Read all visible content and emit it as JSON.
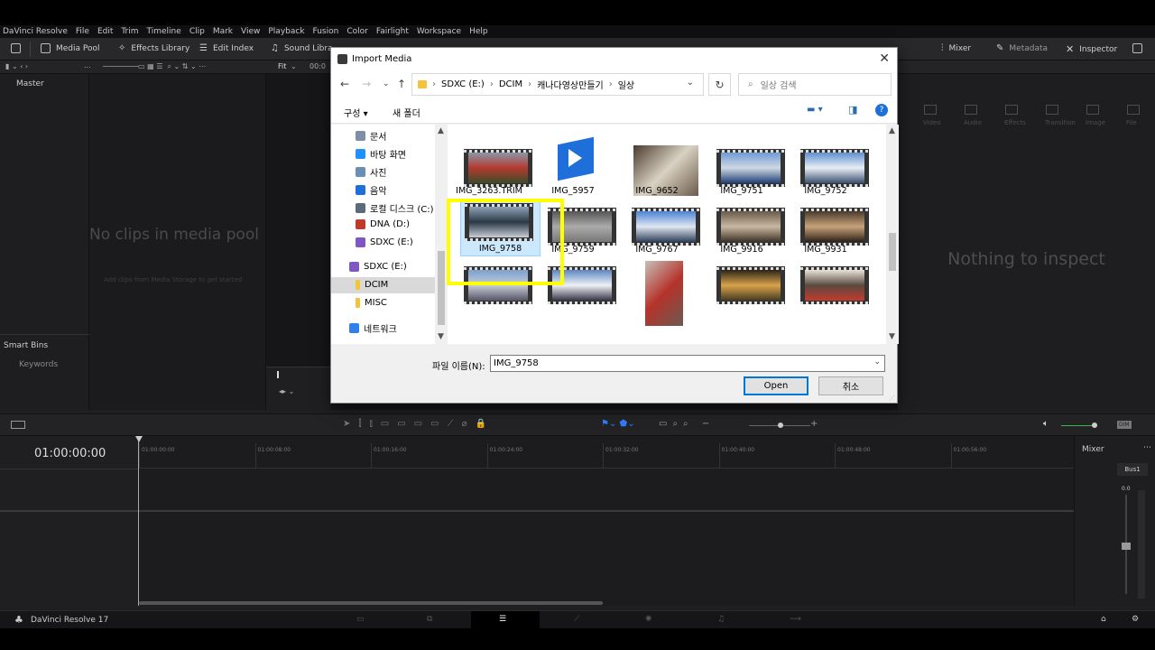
{
  "menubar": [
    "DaVinci Resolve",
    "File",
    "Edit",
    "Trim",
    "Timeline",
    "Clip",
    "Mark",
    "View",
    "Playback",
    "Fusion",
    "Color",
    "Fairlight",
    "Workspace",
    "Help"
  ],
  "toolbar": {
    "media_pool": "Media Pool",
    "effects_library": "Effects Library",
    "edit_index": "Edit Index",
    "sound_library": "Sound Libra",
    "mixer": "Mixer",
    "metadata": "Metadata",
    "inspector": "Inspector"
  },
  "subbar": {
    "fit": "Fit",
    "timecode": "00:0",
    "ellipsis": "..."
  },
  "media_pool": {
    "master": "Master",
    "empty_title": "No clips in media pool",
    "empty_hint": "Add clips from Media Storage to get started",
    "smart_bins": "Smart Bins",
    "keywords": "Keywords"
  },
  "inspector": {
    "empty": "Nothing to inspect",
    "tabs": [
      "Video",
      "Audio",
      "Effects",
      "Transition",
      "Image",
      "File"
    ]
  },
  "timeline": {
    "timecode": "01:00:00:00",
    "ruler": [
      "01:00:00:00",
      "01:00:08:00",
      "01:00:16:00",
      "01:00:24:00",
      "01:00:32:00",
      "01:00:40:00",
      "01:00:48:00",
      "01:00:56:00"
    ]
  },
  "mixer": {
    "title": "Mixer",
    "bus": "Bus1",
    "level": "0.0",
    "dim": "DIM"
  },
  "footer": {
    "app_name": "DaVinci Resolve 17"
  },
  "dialog": {
    "title": "Import Media",
    "breadcrumb": [
      "SDXC (E:)",
      "DCIM",
      "캐나다영상만들기",
      "일상"
    ],
    "search_placeholder": "일상 검색",
    "organize": "구성 ▾",
    "new_folder": "새 폴더",
    "nav": [
      {
        "label": "문서",
        "icon": "document-icon",
        "color": "#7b8fa6"
      },
      {
        "label": "바탕 화면",
        "icon": "desktop-icon",
        "color": "#1e90ff"
      },
      {
        "label": "사진",
        "icon": "pictures-icon",
        "color": "#6a8fb5"
      },
      {
        "label": "음악",
        "icon": "music-icon",
        "color": "#1e6fd9"
      },
      {
        "label": "로컬 디스크 (C:)",
        "icon": "disk-icon",
        "color": "#5a6b7c"
      },
      {
        "label": "DNA (D:)",
        "icon": "drive-icon",
        "color": "#c0392b"
      },
      {
        "label": "SDXC (E:)",
        "icon": "sdcard-icon",
        "color": "#7e57c2"
      },
      {
        "label": "SDXC (E:)",
        "icon": "sdcard-icon",
        "color": "#7e57c2"
      },
      {
        "label": "DCIM",
        "icon": "folder-icon",
        "color": "#f3c43b"
      },
      {
        "label": "MISC",
        "icon": "folder-icon",
        "color": "#f3c43b"
      },
      {
        "label": "네트워크",
        "icon": "network-icon",
        "color": "#2f80ed"
      }
    ],
    "files": [
      {
        "name": "IMG_3263.TRIM",
        "kind": "video",
        "colors": [
          "#8a97a8",
          "#b53a2e",
          "#3b4c2a"
        ]
      },
      {
        "name": "IMG_5957",
        "kind": "app"
      },
      {
        "name": "IMG_9652",
        "kind": "photo",
        "colors": [
          "#4a3a2e",
          "#d9d2c3",
          "#6b5a48"
        ]
      },
      {
        "name": "IMG_9751",
        "kind": "video",
        "colors": [
          "#6d9bd6",
          "#cfd8e3",
          "#1f3f74"
        ]
      },
      {
        "name": "IMG_9752",
        "kind": "video",
        "colors": [
          "#5e8fd0",
          "#e8eef5",
          "#3a4f6e"
        ]
      },
      {
        "name": "IMG_9758",
        "kind": "video",
        "selected": true,
        "colors": [
          "#8fa3b8",
          "#2b3845",
          "#c7ced6"
        ]
      },
      {
        "name": "IMG_9759",
        "kind": "video",
        "colors": [
          "#555",
          "#aaa",
          "#777"
        ]
      },
      {
        "name": "IMG_9767",
        "kind": "video",
        "colors": [
          "#4c83d4",
          "#dfe7f1",
          "#2d3f59"
        ]
      },
      {
        "name": "IMG_9916",
        "kind": "video",
        "colors": [
          "#6a5a4a",
          "#c9b8a0",
          "#3d3026"
        ]
      },
      {
        "name": "IMG_9931",
        "kind": "video",
        "colors": [
          "#4a3b2e",
          "#c7a37a",
          "#2b2018"
        ]
      },
      {
        "name": "",
        "kind": "video",
        "colors": [
          "#7aa0d2",
          "#c7cdd4",
          "#556"
        ]
      },
      {
        "name": "",
        "kind": "video",
        "colors": [
          "#5b86c2",
          "#eef1f6",
          "#334"
        ]
      },
      {
        "name": "",
        "kind": "photo",
        "colors": [
          "#c7c0b8",
          "#b5332b",
          "#6b5a52"
        ]
      },
      {
        "name": "",
        "kind": "video",
        "colors": [
          "#2a2418",
          "#d9a24a",
          "#443a22"
        ]
      },
      {
        "name": "",
        "kind": "video",
        "colors": [
          "#e8e2da",
          "#5a4b3e",
          "#c43a2e"
        ]
      }
    ],
    "filename_label": "파일 이름(N):",
    "filename_value": "IMG_9758",
    "open": "Open",
    "cancel": "취소"
  },
  "highlight_color": "#ffff00",
  "accent": "#0078d7"
}
